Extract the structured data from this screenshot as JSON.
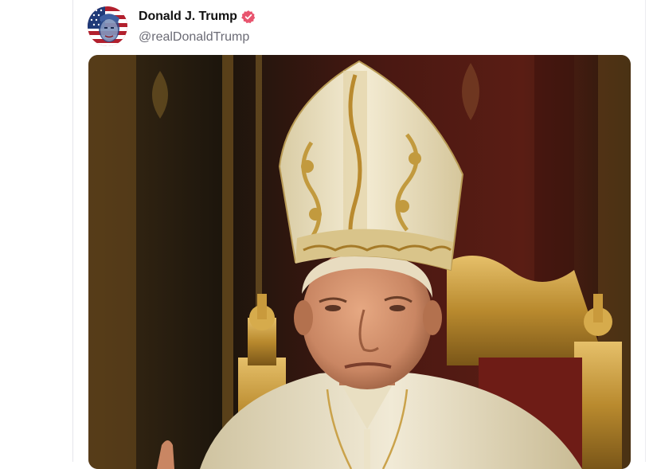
{
  "post": {
    "author": {
      "display_name": "Donald J. Trump",
      "handle": "@realDonaldTrump",
      "verified": true,
      "verified_badge_color": "#e8546e",
      "avatar_icon": "avatar-american-flag-portrait"
    },
    "media": {
      "type": "image",
      "icon": "papal-portrait-image"
    }
  },
  "colors": {
    "text_primary": "#111111",
    "text_secondary": "#6b6b75",
    "divider": "#e6e6ea",
    "background": "#ffffff"
  }
}
